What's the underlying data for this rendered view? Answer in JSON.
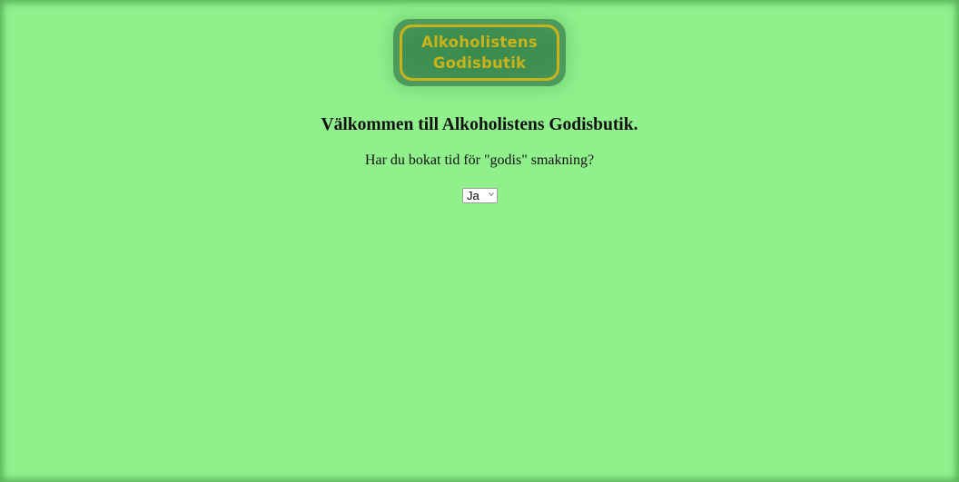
{
  "logo": {
    "line1": "Alkoholistens",
    "line2": "Godisbutik"
  },
  "main": {
    "title": "Välkommen till Alkoholistens Godisbutik.",
    "question": "Har du bokat tid för \"godis\" smakning?",
    "booking_select": {
      "selected_value": "Ja",
      "icon": "chevron-down-icon"
    }
  },
  "colors": {
    "background": "#8ff08c",
    "logo_frame": "#4d9a5e",
    "logo_gold": "#c9b21a"
  }
}
